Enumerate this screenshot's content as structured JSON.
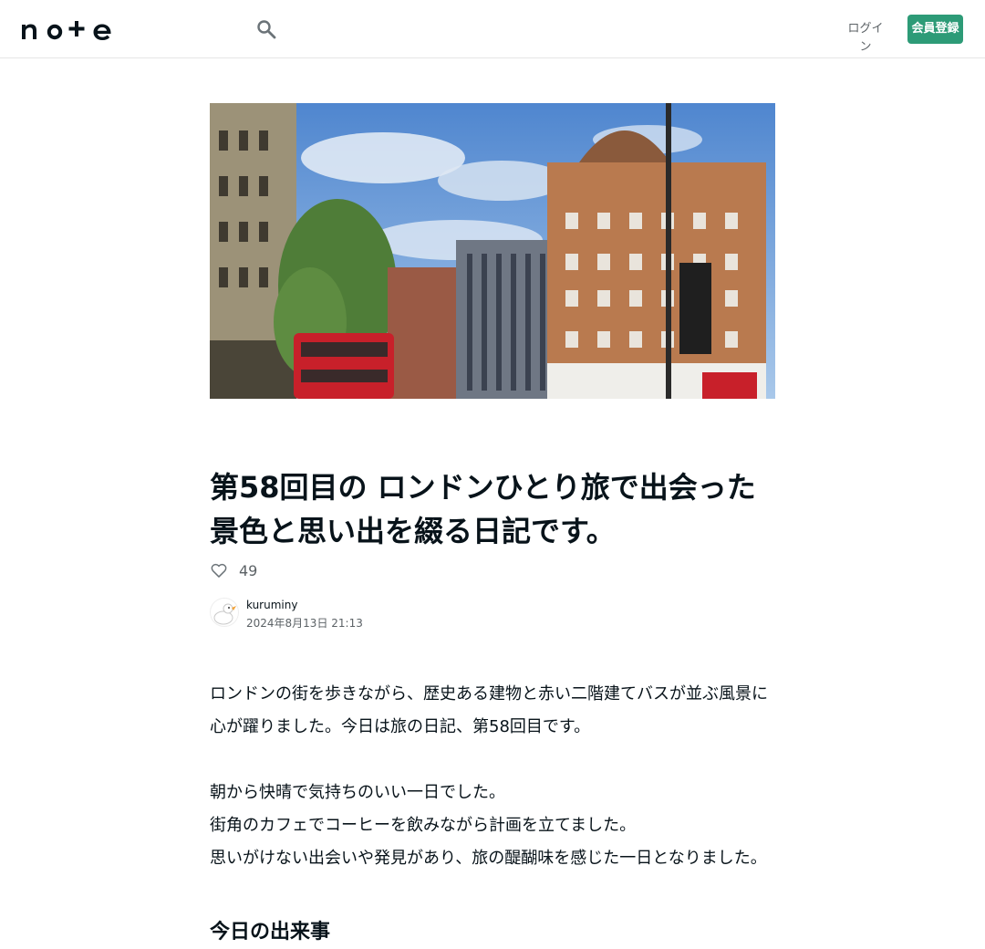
{
  "header": {
    "logo_text": "note",
    "login_label": "ログイン",
    "signup_label": "会員登録"
  },
  "article": {
    "title": "第58回目の ロンドンひとり旅で出会った景色と思い出を綴る日記です。",
    "like_count": "49",
    "author_name": "kuruminy",
    "date": "2024年8月13日 21:13",
    "paragraphs": [
      "ロンドンの街を歩きながら、歴史ある建物と赤い二階建てバスが並ぶ風景に心が躍りました。今日は旅の日記、第58回目です。",
      "",
      "朝から快晴で気持ちのいい一日でした。",
      "街角のカフェでコーヒーを飲みながら計画を立てました。",
      "思いがけない出会いや発見があり、旅の醍醐味を感じた一日となりました。"
    ],
    "section_heading": "今日の出来事"
  },
  "colors": {
    "accent": "#2d9b77",
    "text": "#08131a",
    "muted": "#5c6266"
  },
  "icons": {
    "search": "search-icon",
    "like": "heart-icon"
  }
}
